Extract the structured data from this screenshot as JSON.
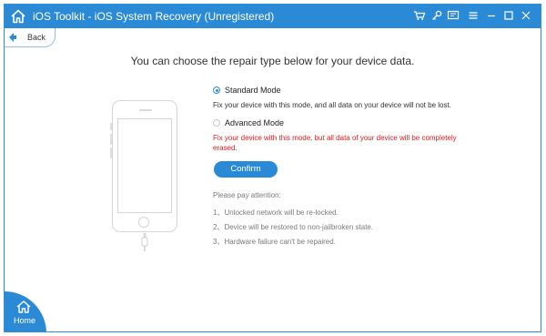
{
  "window": {
    "title": "iOS Toolkit - iOS System Recovery (Unregistered)",
    "accent": "#2b8ad6",
    "title_icons": [
      "cart-icon",
      "key-icon",
      "feedback-icon",
      "menu-icon",
      "minimize-icon",
      "maximize-icon",
      "close-icon"
    ]
  },
  "nav": {
    "back_label": "Back",
    "home_label": "Home"
  },
  "main": {
    "heading": "You can choose the repair type below for your device data.",
    "options": [
      {
        "label": "Standard Mode",
        "checked": true,
        "description": "Fix your device with this mode, and all data on your device will not be lost."
      },
      {
        "label": "Advanced Mode",
        "checked": false,
        "description": "Fix your device with this mode, but all data of your device will be completely erased.",
        "description_color": "#e21c1c"
      }
    ],
    "confirm_label": "Confirm",
    "notes_title": "Please pay attention:",
    "notes": [
      "1、Unlocked network will be re-locked.",
      "2、Device will be restored to non-jailbroken state.",
      "3、Hardware failure can't be repaired."
    ]
  }
}
